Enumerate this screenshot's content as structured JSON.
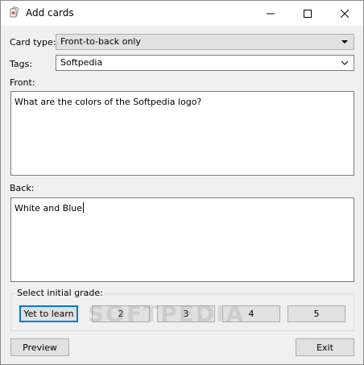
{
  "window": {
    "title": "Add cards"
  },
  "form": {
    "card_type_label": "Card type:",
    "card_type_value": "Front-to-back only",
    "tags_label": "Tags:",
    "tags_value": "Softpedia",
    "front_label": "Front:",
    "front_text": "What are the colors of the Softpedia logo?",
    "back_label": "Back:",
    "back_text": "White and Blue"
  },
  "grade": {
    "title": "Select initial grade:",
    "buttons": [
      "Yet to learn",
      "2",
      "3",
      "4",
      "5"
    ]
  },
  "footer": {
    "preview_label": "Preview",
    "exit_label": "Exit"
  },
  "watermark": "SOFTPEDIA",
  "icons": {
    "app": "cards-app-icon",
    "dropdown": "chevron-down-icon"
  },
  "colors": {
    "focus": "#0078d7",
    "button_bg": "#e1e1e1",
    "window_bg": "#f0f0f0"
  }
}
